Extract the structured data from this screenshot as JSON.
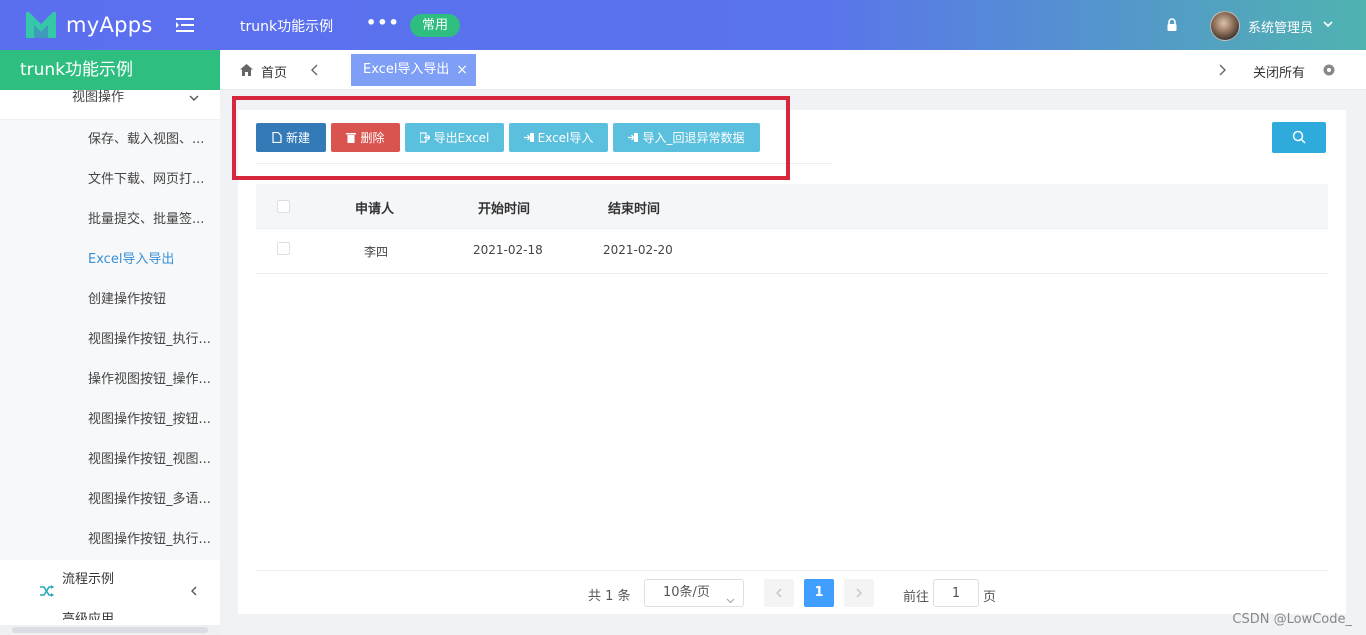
{
  "header": {
    "app_name": "myApps",
    "module_title": "trunk功能示例",
    "more": "•••",
    "badge": "常用",
    "user_name": "系统管理员"
  },
  "sidebar": {
    "title": "trunk功能示例",
    "submenu": "视图操作",
    "items": [
      "保存、载入视图、...",
      "文件下载、网页打...",
      "批量提交、批量签...",
      "Excel导入导出",
      "创建操作按钮",
      "视图操作按钮_执行...",
      "操作视图按钮_操作...",
      "视图操作按钮_按钮...",
      "视图操作按钮_视图...",
      "视图操作按钮_多语...",
      "视图操作按钮_执行..."
    ],
    "active_index": 3,
    "groups": [
      "流程示例",
      "高级应用"
    ]
  },
  "tabs": {
    "home": "首页",
    "active": "Excel导入导出",
    "close": "×",
    "close_all": "关闭所有"
  },
  "toolbar": {
    "new": "新建",
    "delete": "删除",
    "export": "导出Excel",
    "import": "Excel导入",
    "import_rollback": "导入_回退异常数据"
  },
  "table": {
    "columns": [
      "申请人",
      "开始时间",
      "结束时间"
    ],
    "rows": [
      [
        "李四",
        "2021-02-18",
        "2021-02-20"
      ]
    ]
  },
  "pagination": {
    "total": "共 1 条",
    "page_size": "10条/页",
    "current": "1",
    "goto_label": "前往",
    "goto_value": "1",
    "unit": "页"
  },
  "watermark": "CSDN @LowCode_",
  "colors": {
    "accent_green": "#2ebf80",
    "primary_blue": "#337ab7",
    "danger_red": "#d9534f",
    "info_cyan": "#5bc0de",
    "highlight_red": "#d6283d"
  }
}
